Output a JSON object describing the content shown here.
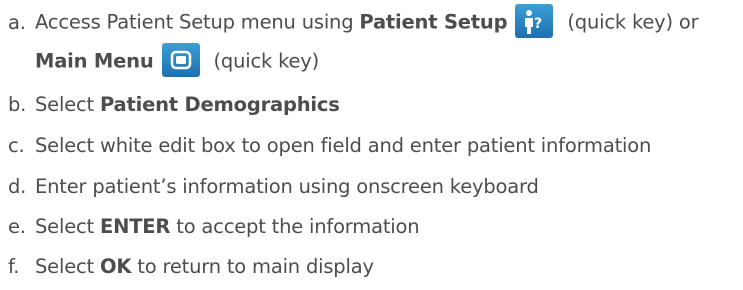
{
  "steps": [
    {
      "marker": "a.",
      "pre": "Access Patient Setup menu using",
      "bold1": "Patient Setup",
      "icon1": "patient-setup-icon",
      "post1": "(quick key) or",
      "bold2": "Main Menu",
      "icon2": "main-menu-icon",
      "post2": "(quick key)"
    },
    {
      "marker": "b.",
      "pre": "Select",
      "bold": "Patient Demographics",
      "post": ""
    },
    {
      "marker": "c.",
      "pre": "Select white edit box to open field and enter patient information"
    },
    {
      "marker": "d.",
      "pre": "Enter patient’s information using onscreen keyboard"
    },
    {
      "marker": "e.",
      "pre": "Select",
      "bold": "ENTER",
      "post": "to accept the information"
    },
    {
      "marker": "f.",
      "pre": "Select",
      "bold": "OK",
      "post": "to return to main display"
    }
  ],
  "colors": {
    "text": "#4d4d4f",
    "quick_key_blue": "#2a86c4"
  }
}
